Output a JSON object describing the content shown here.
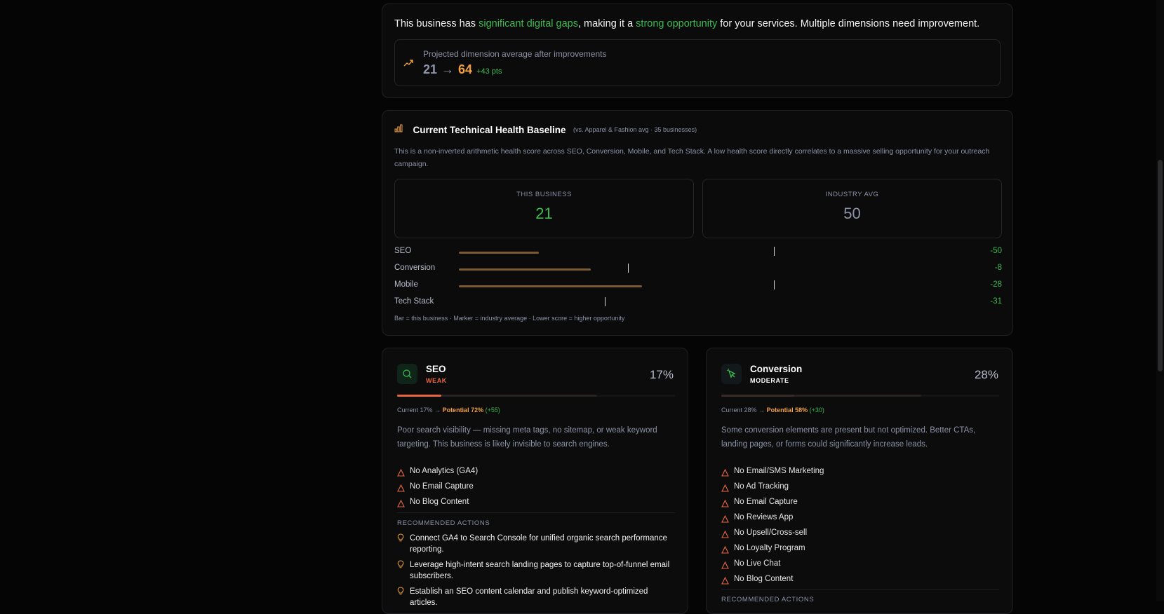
{
  "summary": {
    "pre": "This business has ",
    "hl1": "significant digital gaps",
    "mid": ", making it a ",
    "hl2": "strong opportunity",
    "post": " for your services. Multiple dimensions need improvement.",
    "projection_label": "Projected dimension average after improvements",
    "from_score": "21",
    "arrow": "→",
    "to_score": "64",
    "delta": "+43 pts"
  },
  "baseline": {
    "title": "Current Technical Health Baseline",
    "subtitle": "(vs. Apparel & Fashion avg · 35 businesses)",
    "description": "This is a non-inverted arithmetic health score across SEO, Conversion, Mobile, and Tech Stack. A low health score directly correlates to a massive selling opportunity for your outreach campaign.",
    "this_business_label": "THIS BUSINESS",
    "this_business_value": "21",
    "industry_label": "INDUSTRY AVG",
    "industry_value": "50",
    "dimensions": [
      {
        "name": "SEO",
        "business": 17,
        "industry": 67,
        "diff": "-50"
      },
      {
        "name": "Conversion",
        "business": 28,
        "industry": 36,
        "diff": "-8"
      },
      {
        "name": "Mobile",
        "business": 39,
        "industry": 67,
        "diff": "-28"
      },
      {
        "name": "Tech Stack",
        "business": 0,
        "industry": 31,
        "diff": "-31"
      }
    ],
    "legend": "Bar = this business · Marker = industry average · Lower score = higher opportunity"
  },
  "cards": [
    {
      "name": "SEO",
      "level": "WEAK",
      "level_color": "#e8663d",
      "icon": "search-icon",
      "percent": "17%",
      "fill_fraction": 0.17,
      "fill_color": "#e8663d",
      "current": "Current 17%",
      "arrow": "→",
      "potential": "Potential 72%",
      "gain": "(+55)",
      "description": "Poor search visibility — missing meta tags, no sitemap, or weak keyword targeting. This business is likely invisible to search engines.",
      "issues": [
        "No Analytics (GA4)",
        "No Email Capture",
        "No Blog Content"
      ],
      "rec_title": "RECOMMENDED ACTIONS",
      "recommendations": [
        "Connect GA4 to Search Console for unified organic search performance reporting.",
        "Leverage high-intent search landing pages to capture top-of-funnel email subscribers.",
        "Establish an SEO content calendar and publish keyword-optimized articles."
      ]
    },
    {
      "name": "Conversion",
      "level": "MODERATE",
      "level_color": "#ffffff",
      "icon": "cursor-click-icon",
      "percent": "28%",
      "fill_fraction": 0.28,
      "fill_color": "#3a2d28",
      "current": "Current 28%",
      "arrow": "→",
      "potential": "Potential 58%",
      "gain": "(+30)",
      "description": "Some conversion elements are present but not optimized. Better CTAs, landing pages, or forms could significantly increase leads.",
      "issues": [
        "No Email/SMS Marketing",
        "No Ad Tracking",
        "No Email Capture",
        "No Reviews App",
        "No Upsell/Cross-sell",
        "No Loyalty Program",
        "No Live Chat",
        "No Blog Content"
      ],
      "rec_title": "RECOMMENDED ACTIONS",
      "recommendations": []
    }
  ]
}
